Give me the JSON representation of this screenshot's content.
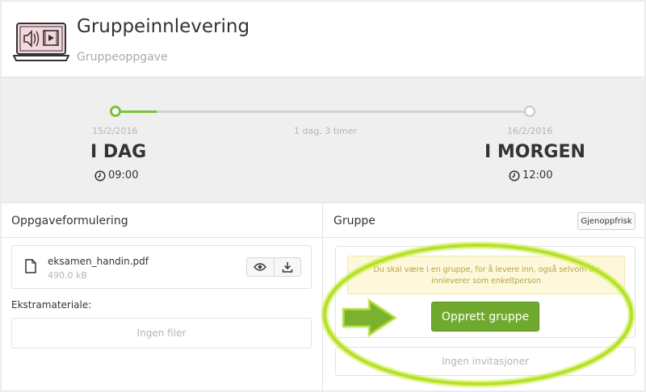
{
  "header": {
    "title": "Gruppeinnlevering",
    "subtitle": "Gruppeoppgave",
    "icon": "laptop-media-icon"
  },
  "timeline": {
    "progress": 0.09,
    "start": {
      "date": "15/2/2016",
      "label": "I DAG",
      "time": "09:00"
    },
    "duration": "1 dag, 3 timer",
    "end": {
      "date": "16/2/2016",
      "label": "I MORGEN",
      "time": "12:00"
    }
  },
  "assignment": {
    "title": "Oppgaveformulering",
    "file": {
      "name": "eksamen_handin.pdf",
      "size": "490.0 kB"
    },
    "extra_label": "Ekstramateriale:",
    "extra_empty": "Ingen filer"
  },
  "group": {
    "title": "Gruppe",
    "refresh_label": "Gjenoppfrisk",
    "warning": "Du skal være i en gruppe, for å levere inn, også selvom du innleverer som enkeltperson",
    "create_label": "Opprett gruppe",
    "invitations_empty": "Ingen invitasjoner"
  },
  "colors": {
    "accent": "#7cc13a",
    "button": "#6fa92e",
    "warning_bg": "#fcf8d9",
    "warning_text": "#b8a24a",
    "highlight": "#b7e02a"
  }
}
